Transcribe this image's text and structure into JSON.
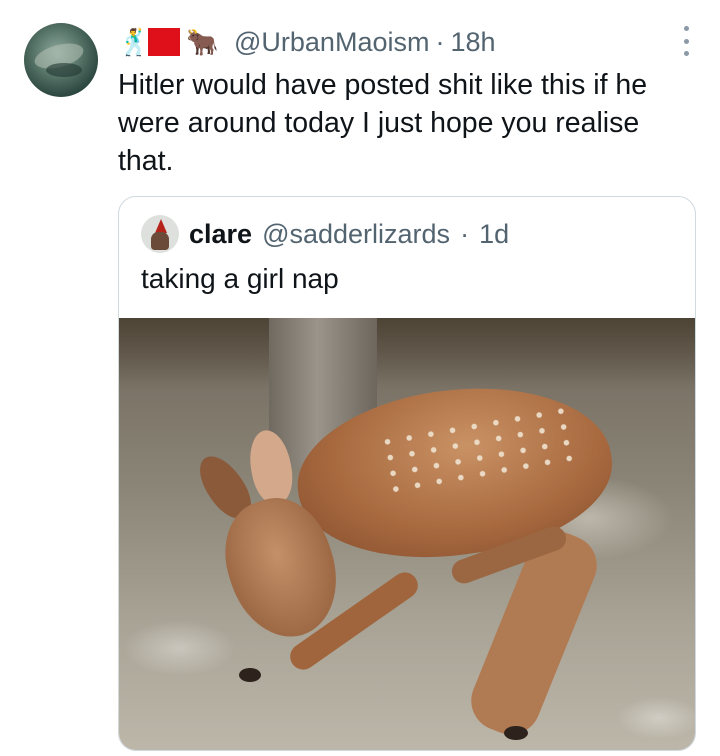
{
  "tweet": {
    "header": {
      "emoji_figure": "🕺",
      "emoji_ox": "🐂",
      "handle": "@UrbanMaoism",
      "separator": "·",
      "time": "18h"
    },
    "text": "Hitler would have posted shit like this if he were around today I just hope you realise that."
  },
  "quoted_tweet": {
    "name": "clare",
    "handle": "@sadderlizards",
    "separator": "·",
    "time": "1d",
    "text": "taking a girl nap"
  },
  "colors": {
    "text_primary": "#0f1419",
    "text_secondary": "#536471",
    "border": "#cfd9de",
    "flag_red": "#e0101a"
  },
  "icons": {
    "more": "more-vertical-icon"
  }
}
